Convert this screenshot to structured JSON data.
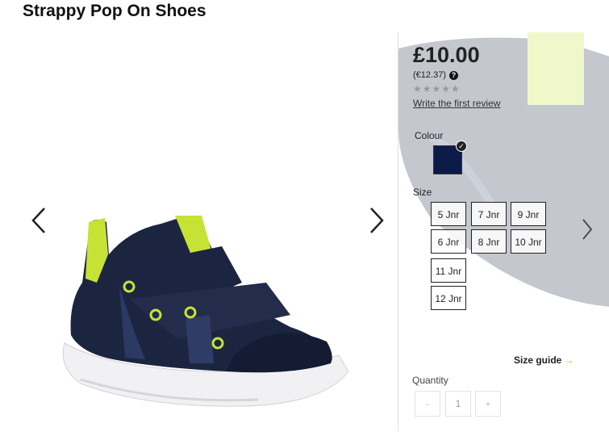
{
  "product": {
    "title": "Strappy Pop On Shoes"
  },
  "gallery": {
    "prev_icon": "chevron-left-icon",
    "next_icon": "chevron-right-icon"
  },
  "details": {
    "price": "£10.00",
    "alt_price": "(€12.37)",
    "help_icon": "?",
    "rating_stars": "★★★★★",
    "review_link": "Write the first review",
    "colour_label": "Colour",
    "selected_colour": "#0c1a4a",
    "size_label": "Size",
    "sizes": [
      "5 Jnr",
      "7 Jnr",
      "9 Jnr",
      "6 Jnr",
      "8 Jnr",
      "10 Jnr",
      "11 Jnr",
      "12 Jnr"
    ],
    "size_guide": "Size guide",
    "size_guide_arrow": "→",
    "quantity_label": "Quantity",
    "qty_minus": "-",
    "qty_value": "1",
    "qty_plus": "+"
  },
  "colors": {
    "accent": "#e8a317",
    "shoe_navy": "#1c2540",
    "lime": "#c6e335"
  }
}
